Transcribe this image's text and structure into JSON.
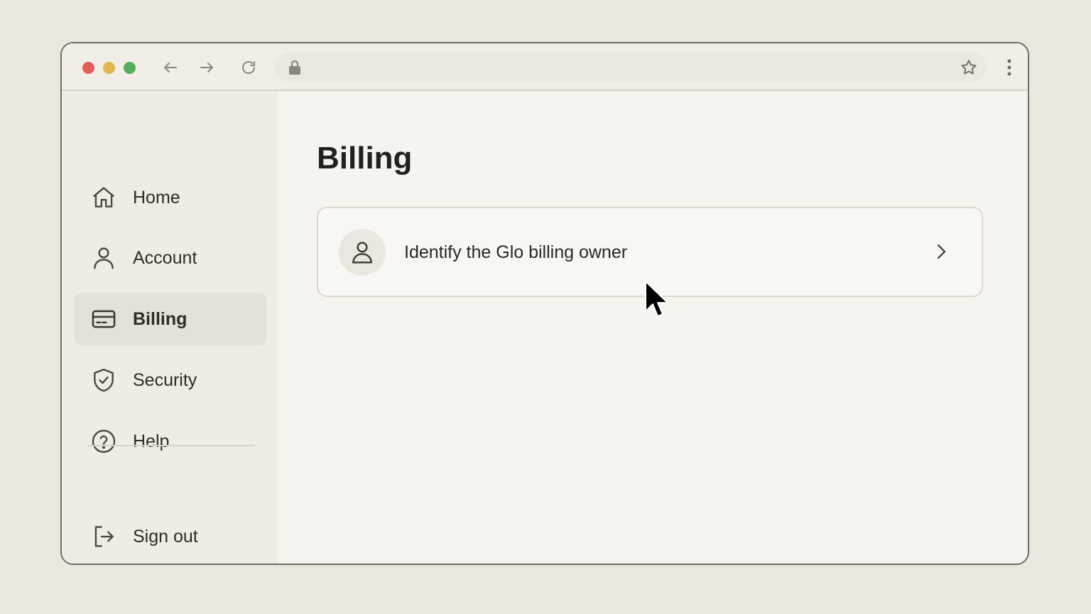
{
  "browser": {
    "url": "",
    "icons": [
      "back-arrow-icon",
      "forward-arrow-icon",
      "reload-icon",
      "lock-icon",
      "star-icon",
      "more-vertical-icon"
    ]
  },
  "sidebar": {
    "items": [
      {
        "label": "Home",
        "icon": "home-icon",
        "active": false
      },
      {
        "label": "Account",
        "icon": "user-icon",
        "active": false
      },
      {
        "label": "Billing",
        "icon": "credit-card-icon",
        "active": true
      },
      {
        "label": "Security",
        "icon": "shield-check-icon",
        "active": false
      },
      {
        "label": "Help",
        "icon": "help-circle-icon",
        "active": false
      }
    ],
    "signout": {
      "label": "Sign out",
      "icon": "sign-out-icon"
    }
  },
  "main": {
    "title": "Billing",
    "card": {
      "label": "Identify the Glo billing owner",
      "icon": "user-icon"
    }
  },
  "colors": {
    "background": "#ebe7dd",
    "window": "#f6f4ef",
    "sidebar": "#efece5",
    "active_item": "#e5e1d8",
    "traffic_red": "#e45e55",
    "traffic_yellow": "#e2b64b",
    "traffic_green": "#56ad5c"
  }
}
